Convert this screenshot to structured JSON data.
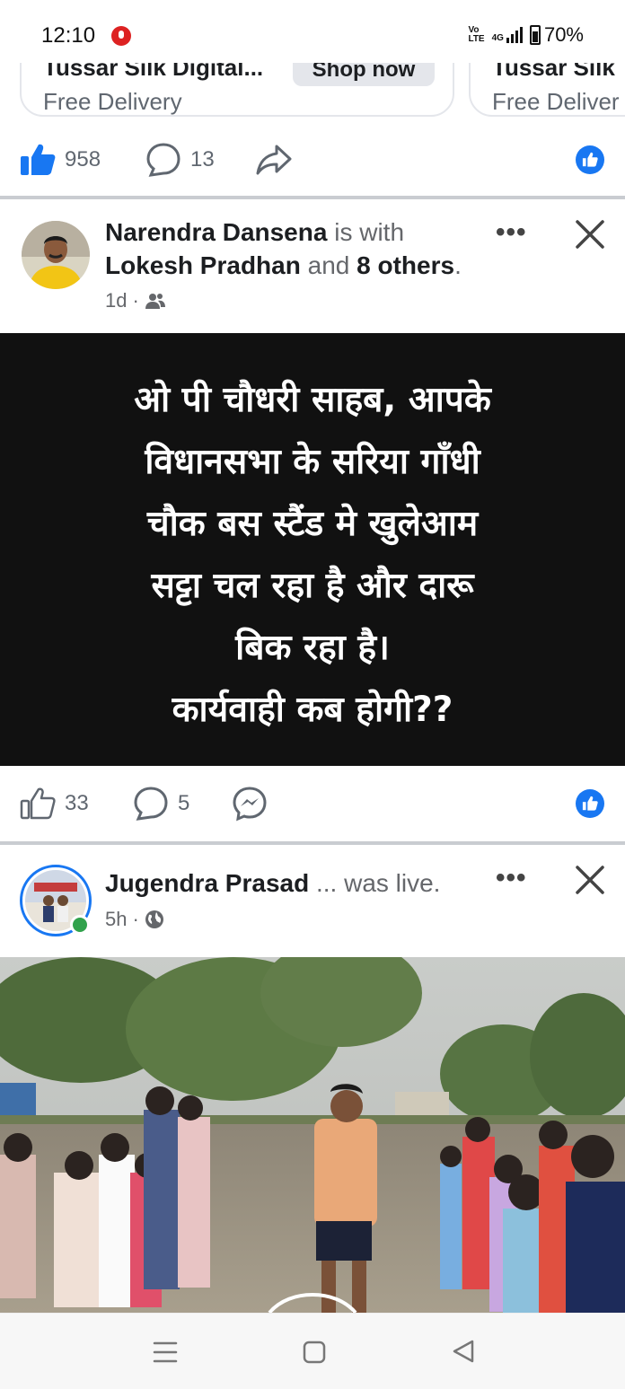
{
  "status_bar": {
    "time": "12:10",
    "network_label_1": "Vo",
    "network_label_2": "LTE",
    "signal_label": "4G",
    "battery": "70%"
  },
  "ad_carousel": [
    {
      "title": "Tussar Silk Digital...",
      "subtitle": "Free Delivery",
      "button": "Shop now"
    },
    {
      "title": "Tussar Silk",
      "subtitle": "Free Deliver"
    }
  ],
  "post_prev_actions": {
    "likes": "958",
    "comments": "13"
  },
  "post1": {
    "author": "Narendra Dansena",
    "with_text": " is with",
    "tagged": "Lokesh Pradhan",
    "and_text": " and ",
    "others": "8 others",
    "period": ".",
    "time": "1d",
    "text_lines": [
      "ओ पी चौधरी साहब, आपके",
      "विधानसभा के सरिया गाँधी",
      "चौक बस स्टैंड मे खुलेआम",
      "सट्टा चल रहा है और दारू",
      "बिक रहा है।",
      "कार्यवाही कब होगी??"
    ],
    "likes": "33",
    "comments": "5"
  },
  "post2": {
    "author": "Jugendra Prasad",
    "status_text": " ... was live.",
    "time": "5h"
  },
  "colors": {
    "facebook_blue": "#1877f2",
    "text_card_bg": "#111111",
    "online_green": "#31a24c"
  }
}
